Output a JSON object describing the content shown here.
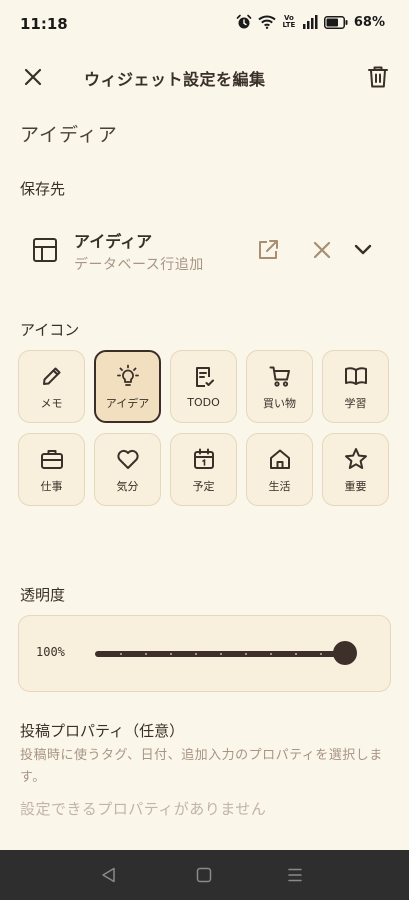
{
  "status": {
    "time": "11:18",
    "volte_top": "Vo",
    "volte_bottom": "LTE",
    "battery": "68%"
  },
  "header": {
    "title": "ウィジェット設定を編集",
    "close_icon": "close-icon",
    "delete_icon": "trash-icon"
  },
  "widget_name": "アイディア",
  "destination": {
    "label": "保存先",
    "name": "アイディア",
    "subtitle": "データベース行追加"
  },
  "icon_section": {
    "label": "アイコン",
    "selected": "アイデア",
    "items": [
      {
        "label": "メモ",
        "icon": "pencil-icon"
      },
      {
        "label": "アイデア",
        "icon": "lightbulb-icon"
      },
      {
        "label": "TODO",
        "icon": "todo-icon"
      },
      {
        "label": "買い物",
        "icon": "cart-icon"
      },
      {
        "label": "学習",
        "icon": "book-icon"
      },
      {
        "label": "仕事",
        "icon": "briefcase-icon"
      },
      {
        "label": "気分",
        "icon": "heart-icon"
      },
      {
        "label": "予定",
        "icon": "calendar-icon"
      },
      {
        "label": "生活",
        "icon": "home-icon"
      },
      {
        "label": "重要",
        "icon": "star-icon"
      }
    ]
  },
  "opacity": {
    "label": "透明度",
    "value_text": "100%",
    "value": 1.0
  },
  "properties": {
    "label": "投稿プロパティ（任意）",
    "description": "投稿時に使うタグ、日付、追加入力のプロパティを選択します。",
    "empty": "設定できるプロパティがありません"
  },
  "colors": {
    "background": "#fbf6ea",
    "accent": "#3d302a",
    "tile": "#f8efdc",
    "tile_selected": "#f1dfc0",
    "muted": "#a89584"
  }
}
